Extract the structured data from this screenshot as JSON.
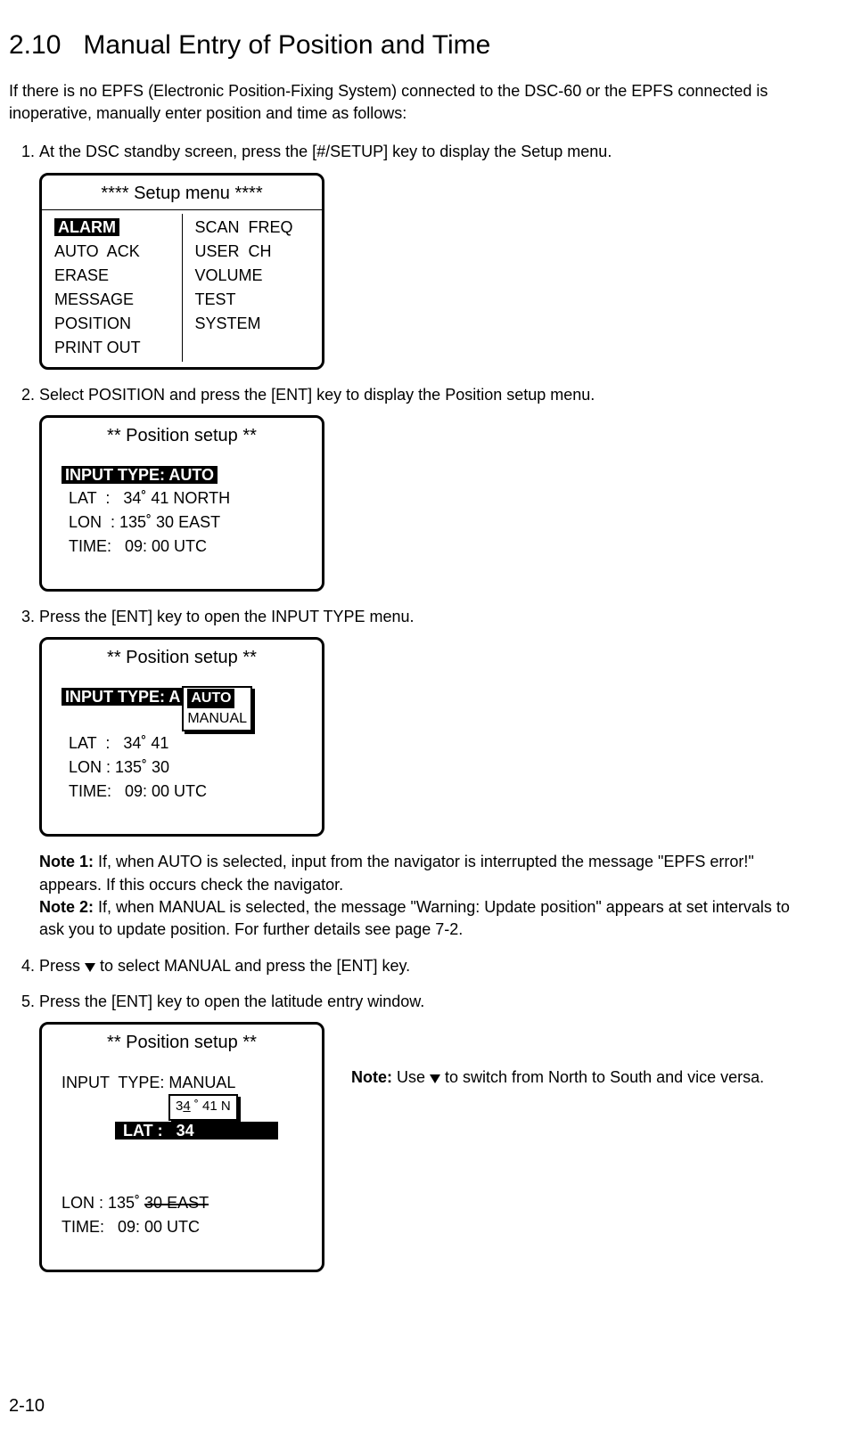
{
  "section": {
    "number": "2.10",
    "title": "Manual Entry of Position and Time"
  },
  "intro": "If there is no EPFS (Electronic Position-Fixing System) connected to the DSC-60 or the EPFS connected is inoperative, manually enter position and time as follows:",
  "steps": {
    "s1": "At the DSC standby screen, press the [#/SETUP] key to display the Setup menu.",
    "s2": "Select POSITION and press the [ENT] key to display the Position setup menu.",
    "s3": "Press the [ENT] key to open the INPUT TYPE menu.",
    "s4a": "Press ",
    "s4b": " to select MANUAL and press the [ENT] key.",
    "s5": "Press the [ENT] key to open the latitude entry window."
  },
  "setupMenu": {
    "title": "****    Setup menu    ****",
    "left": [
      "ALARM",
      "AUTO  ACK",
      "ERASE",
      "MESSAGE",
      "POSITION",
      "PRINT OUT"
    ],
    "right": [
      "SCAN  FREQ",
      "USER  CH",
      "VOLUME",
      "",
      "TEST",
      "SYSTEM"
    ]
  },
  "posPanel1": {
    "title": "**      Position setup      **",
    "inputType": "INPUT  TYPE: AUTO",
    "lat": "LAT  :   34˚ 41 NORTH",
    "lon": "LON  : 135˚ 30 EAST",
    "time": "TIME:   09: 00 UTC"
  },
  "posPanel2": {
    "title": "**      Position setup      **",
    "inputTypeLabel": "INPUT  TYPE: A",
    "dropdown": {
      "selected": "AUTO",
      "other": "MANUAL"
    },
    "lat": "LAT  :   34˚ 41",
    "lon": "LON : 135˚ 30",
    "time": "TIME:   09: 00 UTC"
  },
  "notes": {
    "n1label": "Note 1:",
    "n1text": " If, when AUTO is selected, input from the navigator is interrupted the message \"EPFS error!\" appears. If this occurs check the navigator.",
    "n2label": "Note 2:",
    "n2text": " If, when MANUAL is selected, the message \"Warning: Update position\" appears at set intervals to ask you to update position. For further details see page 7-2."
  },
  "posPanel3": {
    "title": "**      Position setup      **",
    "inputType": "INPUT  TYPE: MANUAL",
    "latHL": " LAT :   34                  ",
    "latBoxPre": "3",
    "latBoxCur": "4",
    "latBoxPost": " ˚ 41 N",
    "lonPre": "LON : 135˚ ",
    "lonStrike": "30 EAST",
    "time": "TIME:   09: 00 UTC"
  },
  "sideNote": {
    "pre": "Note:",
    "textA": " Use ",
    "textB": " to switch from North to South and vice versa."
  },
  "pageNumber": "2-10"
}
